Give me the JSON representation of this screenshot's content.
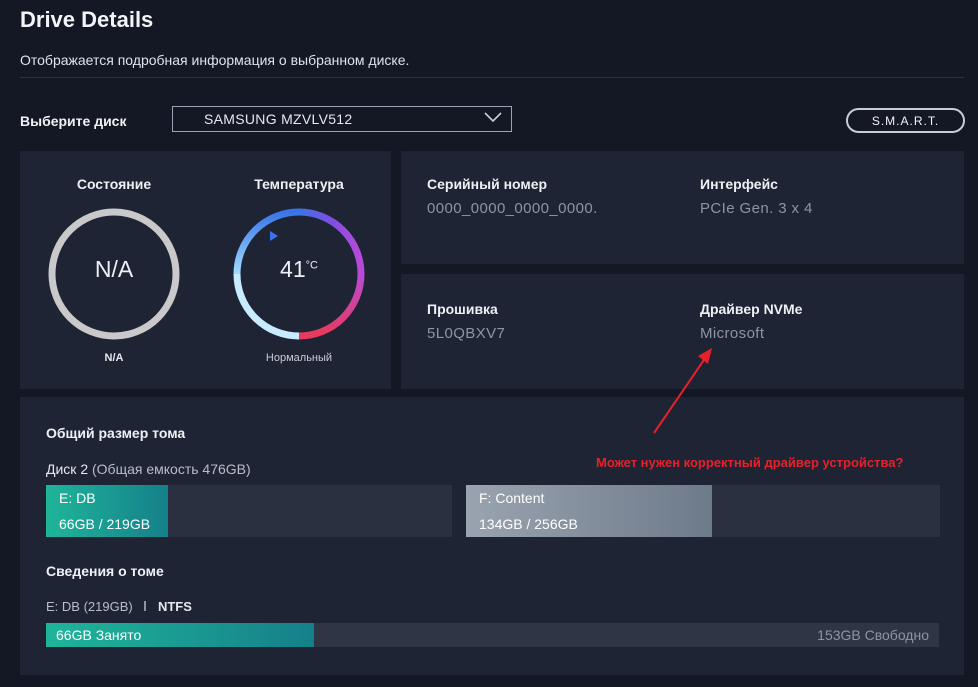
{
  "header": {
    "title": "Drive Details",
    "subtitle": "Отображается подробная информация о выбранном диске."
  },
  "disk_select": {
    "label": "Выберите диск",
    "selected": "SAMSUNG MZVLV512"
  },
  "smart_button": "S.M.A.R.T.",
  "status": {
    "title": "Состояние",
    "value": "N/A",
    "caption": "N/A"
  },
  "temperature": {
    "title": "Температура",
    "value": "41",
    "unit": "°C",
    "caption": "Нормальный"
  },
  "info": {
    "serial_label": "Серийный номер",
    "serial_value": "0000_0000_0000_0000.",
    "interface_label": "Интерфейс",
    "interface_value": "PCIe Gen. 3 x 4",
    "firmware_label": "Прошивка",
    "firmware_value": "5L0QBXV7",
    "driver_label": "Драйвер NVMe",
    "driver_value": "Microsoft"
  },
  "annotation": "Может нужен корректный драйвер устройства?",
  "volume": {
    "section_title": "Общий размер тома",
    "disk_name": "Диск 2",
    "disk_capacity": "(Общая емкость 476GB)",
    "partitions": [
      {
        "name": "E: DB",
        "usage": "66GB / 219GB",
        "fill": 0.3,
        "color": "#1fb59a"
      },
      {
        "name": "F: Content",
        "usage": "134GB / 256GB",
        "fill": 0.52,
        "color": "#8a96a4"
      }
    ]
  },
  "volume_info": {
    "section_title": "Сведения о томе",
    "volume_name": "E: DB (219GB)",
    "filesystem": "NTFS",
    "used_label": "66GB Занято",
    "free_label": "153GB Свободно",
    "used_fraction": 0.3
  },
  "colors": {
    "accent_teal": "#1fb59a",
    "annotation_red": "#e8202a"
  }
}
